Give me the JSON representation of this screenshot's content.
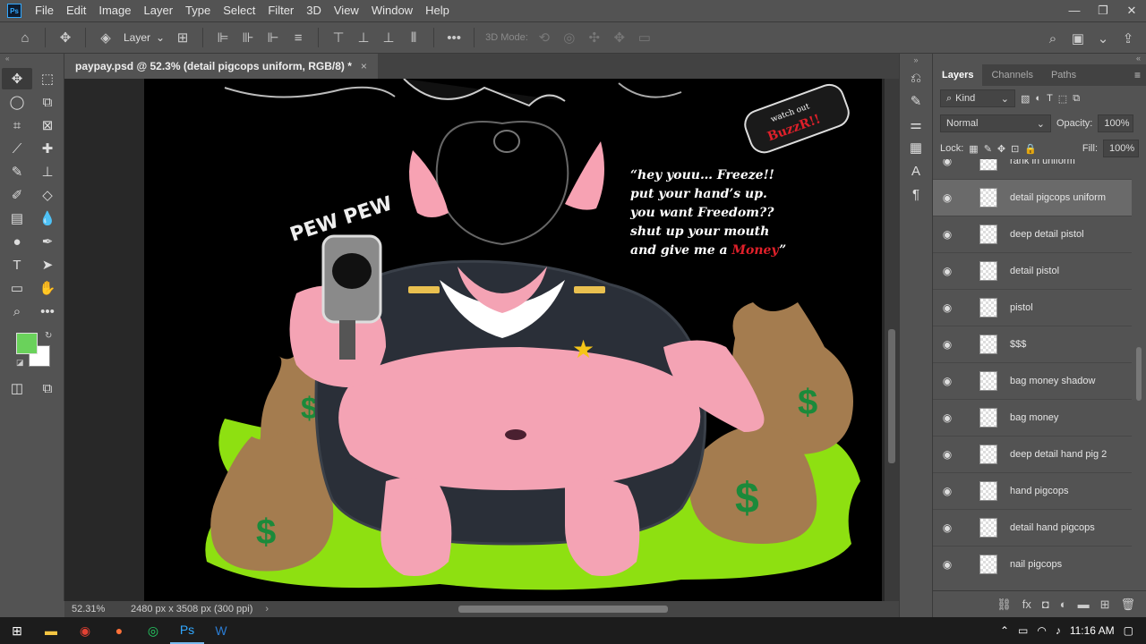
{
  "menu": {
    "items": [
      "File",
      "Edit",
      "Image",
      "Layer",
      "Type",
      "Select",
      "Filter",
      "3D",
      "View",
      "Window",
      "Help"
    ],
    "window_controls": [
      "—",
      "❐",
      "✕"
    ]
  },
  "options_bar": {
    "layer_select": "Layer",
    "mode_label": "3D Mode:",
    "more": "•••"
  },
  "document": {
    "tab_title": "paypay.psd @ 52.3% (detail pigcops uniform, RGB/8) *",
    "close": "×",
    "zoom": "52.31%",
    "dimensions": "2480 px x 3508 px (300 ppi)"
  },
  "artwork": {
    "quote_lines": [
      "“hey youu… Freeze!!",
      "put your hand’s up.",
      "you want Freedom??",
      "shut up your mouth"
    ],
    "quote_last_prefix": "and give me a ",
    "quote_money": "Money",
    "quote_end": "”",
    "sticker_top": "watch out",
    "sticker_name": "BuzzR!!",
    "pew": "PEW PEW"
  },
  "layers_panel": {
    "tabs": [
      "Layers",
      "Channels",
      "Paths"
    ],
    "filter_kind": "Kind",
    "blend_mode": "Normal",
    "opacity_label": "Opacity:",
    "opacity_value": "100%",
    "lock_label": "Lock:",
    "fill_label": "Fill:",
    "fill_value": "100%",
    "layers": [
      {
        "name": "rank in uniform",
        "selected": false
      },
      {
        "name": "detail pigcops uniform",
        "selected": true
      },
      {
        "name": "deep detail pistol",
        "selected": false
      },
      {
        "name": "detail pistol",
        "selected": false
      },
      {
        "name": "pistol",
        "selected": false
      },
      {
        "name": "$$$",
        "selected": false
      },
      {
        "name": "bag money shadow",
        "selected": false
      },
      {
        "name": "bag money",
        "selected": false
      },
      {
        "name": "deep detail hand pig 2",
        "selected": false
      },
      {
        "name": "hand pigcops",
        "selected": false
      },
      {
        "name": "detail hand pigcops",
        "selected": false
      },
      {
        "name": "nail pigcops",
        "selected": false
      }
    ]
  },
  "colors": {
    "foreground": "#6ad25b",
    "background": "#ffffff",
    "accent": "#31a8ff"
  },
  "taskbar": {
    "time": "11:16 AM"
  }
}
